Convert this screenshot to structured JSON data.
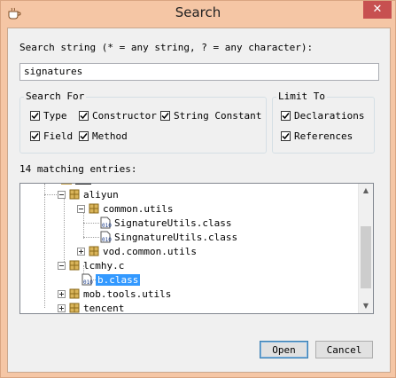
{
  "window": {
    "title": "Search",
    "close_glyph": "✕",
    "title_icon": "coffee-cup-icon"
  },
  "search": {
    "label": "Search string (* = any string, ? = any character):",
    "value": "signatures"
  },
  "search_for": {
    "title": "Search For",
    "options": [
      {
        "label": "Type",
        "checked": true
      },
      {
        "label": "Constructor",
        "checked": true
      },
      {
        "label": "String Constant",
        "checked": true
      },
      {
        "label": "Field",
        "checked": true
      },
      {
        "label": "Method",
        "checked": true
      }
    ]
  },
  "limit_to": {
    "title": "Limit To",
    "options": [
      {
        "label": "Declarations",
        "checked": true
      },
      {
        "label": "References",
        "checked": true
      }
    ]
  },
  "results": {
    "count_label": "14 matching entries:",
    "items": [
      {
        "label": "aliyun",
        "type": "package",
        "expander": "minus"
      },
      {
        "label": "common.utils",
        "type": "package",
        "expander": "minus"
      },
      {
        "label": "SignatureUtils.class",
        "type": "class"
      },
      {
        "label": "SingnatureUtils.class",
        "type": "class"
      },
      {
        "label": "vod.common.utils",
        "type": "package",
        "expander": "plus"
      },
      {
        "label": "lcmhy.c",
        "type": "package",
        "expander": "minus"
      },
      {
        "label": "b.class",
        "type": "class",
        "selected": true
      },
      {
        "label": "mob.tools.utils",
        "type": "package",
        "expander": "plus"
      },
      {
        "label": "tencent",
        "type": "package",
        "expander": "plus"
      }
    ]
  },
  "buttons": {
    "open": "Open",
    "cancel": "Cancel"
  },
  "colors": {
    "title_bar": "#f5c6a5",
    "close_button": "#c75050",
    "selection": "#3399ff",
    "package_icon": "#c7a24a"
  }
}
